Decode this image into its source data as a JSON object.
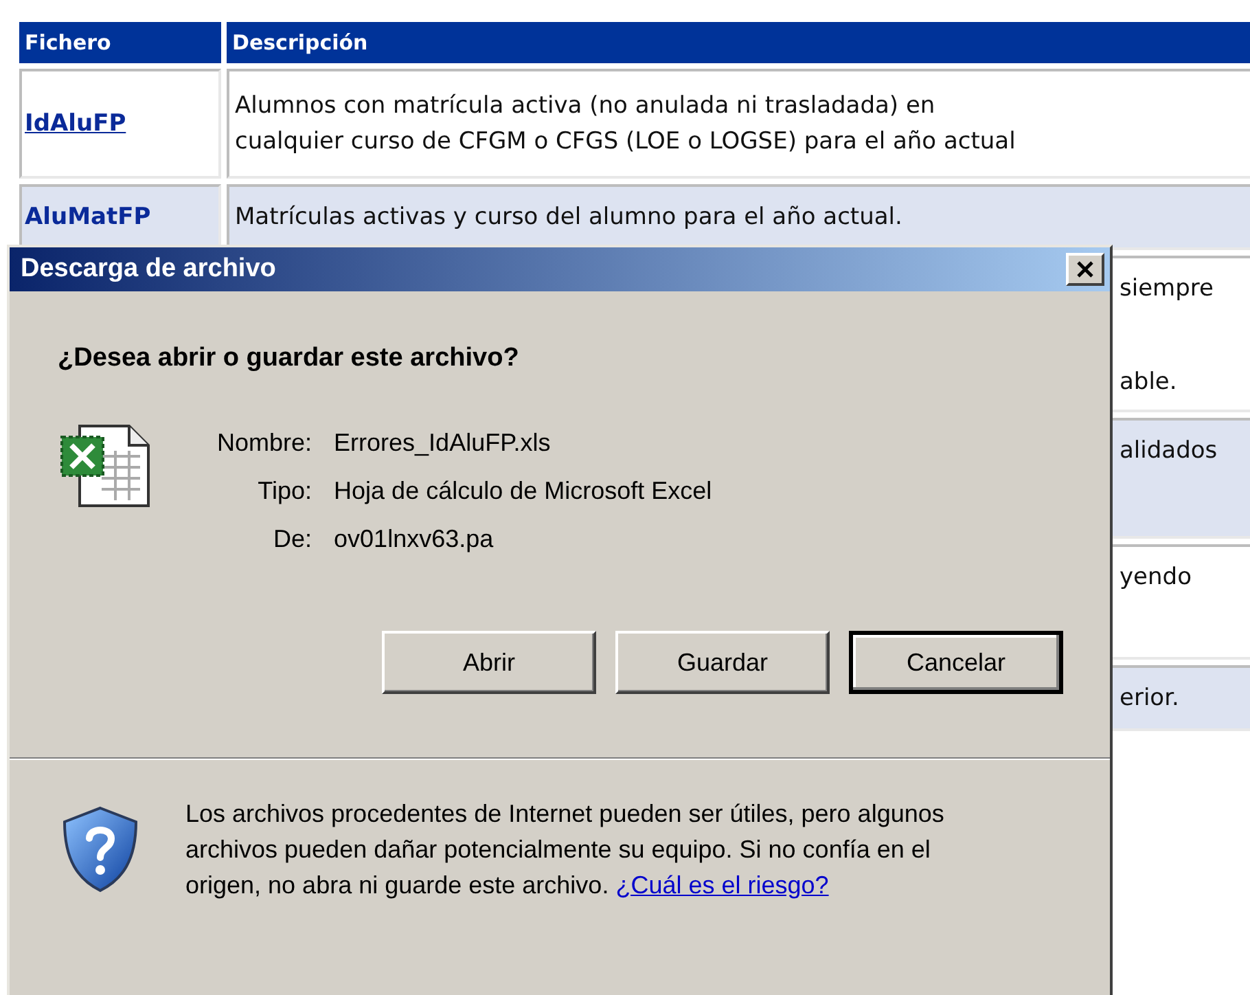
{
  "table": {
    "columns": [
      "Fichero",
      "Descripción"
    ],
    "rows": [
      {
        "file": "IdAluFP",
        "lines": [
          "Alumnos con matrícula activa (no anulada ni trasladada) en",
          "cualquier curso de CFGM o CFGS (LOE o LOGSE) para el año actual"
        ]
      },
      {
        "file": "AluMatFP",
        "lines": [
          "Matrículas activas y curso del alumno para el año actual."
        ]
      },
      {
        "lines": [
          "siempre",
          "able."
        ]
      },
      {
        "lines": [
          "alidados"
        ]
      },
      {
        "lines": [
          "yendo"
        ]
      },
      {
        "lines": [
          "erior."
        ]
      }
    ]
  },
  "dialog": {
    "title": "Descarga de archivo",
    "question": "¿Desea abrir o guardar este archivo?",
    "fields": [
      {
        "label": "Nombre:",
        "value": "Errores_IdAluFP.xls"
      },
      {
        "label": "Tipo:",
        "value": "Hoja de cálculo de Microsoft Excel"
      },
      {
        "label": "De:",
        "value": "ov01lnxv63.pa"
      }
    ],
    "buttons": [
      {
        "label": "Abrir",
        "default": false
      },
      {
        "label": "Guardar",
        "default": false
      },
      {
        "label": "Cancelar",
        "default": true
      }
    ],
    "warning": {
      "text": "Los archivos procedentes de Internet pueden ser útiles, pero algunos archivos pueden dañar potencialmente su equipo. Si no confía en el origen, no abra ni guarde este archivo.",
      "link": "¿Cuál es el riesgo?"
    }
  }
}
